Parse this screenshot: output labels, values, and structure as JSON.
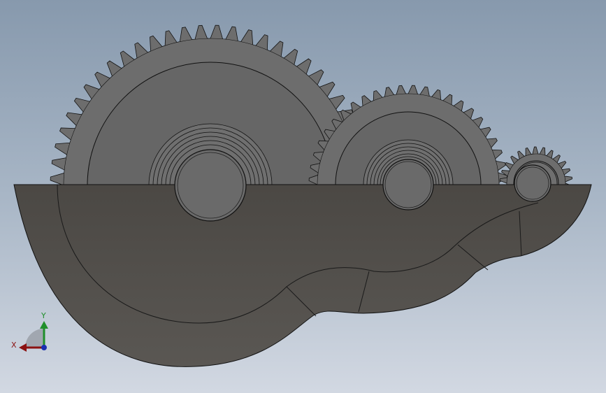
{
  "viewport": {
    "background_top": "#8799ad",
    "background_bottom": "#d2d8e2"
  },
  "model": {
    "part_color": "#6d6d6d",
    "housing_color": "#4a4743",
    "edge_color": "#111111",
    "gears": [
      {
        "name": "large-gear",
        "teeth": 60
      },
      {
        "name": "medium-gear",
        "teeth": 48
      },
      {
        "name": "small-gear",
        "teeth": 26
      }
    ]
  },
  "triad": {
    "x_label": "X",
    "y_label": "Y",
    "x_color": "#8b1111",
    "y_color": "#1f8f2a",
    "z_color": "#1b2fb0"
  }
}
